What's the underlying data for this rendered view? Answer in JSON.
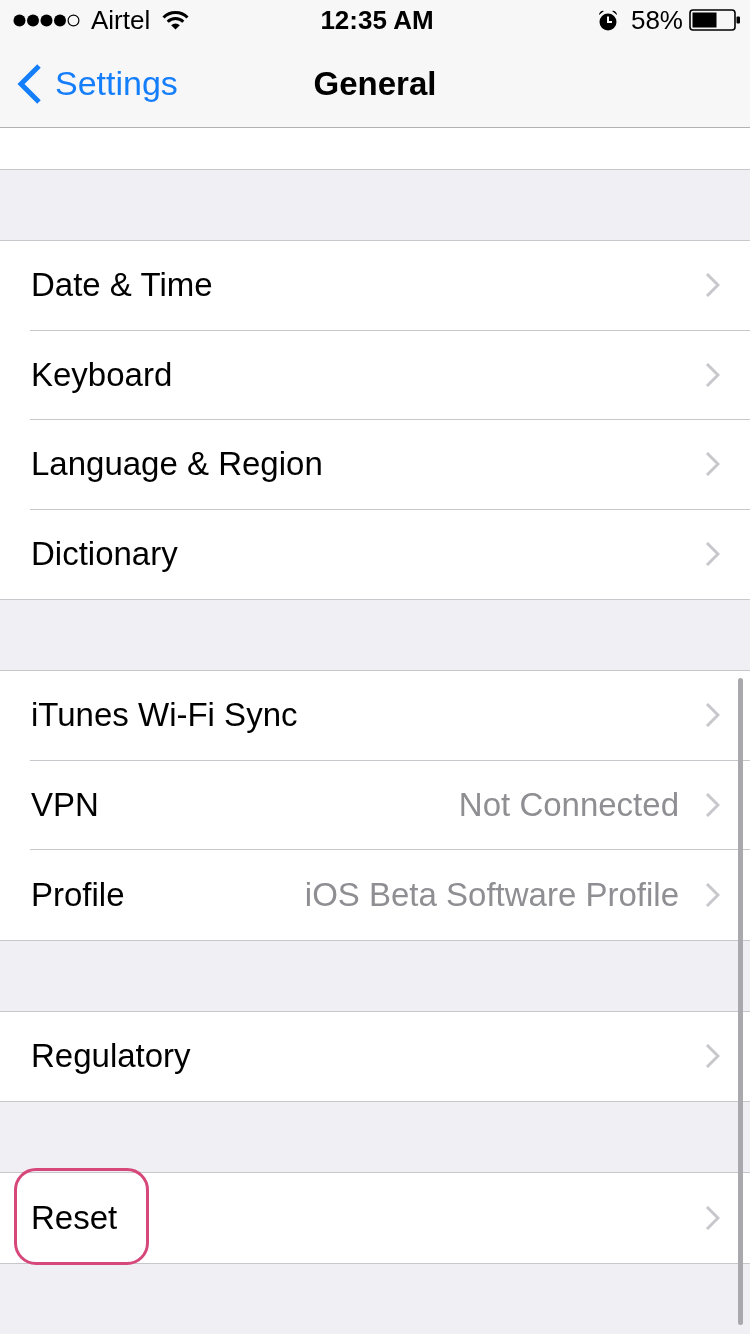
{
  "status_bar": {
    "carrier": "Airtel",
    "time": "12:35 AM",
    "battery": "58%"
  },
  "nav_bar": {
    "back_label": "Settings",
    "title": "General"
  },
  "groups": [
    {
      "rows": [
        {
          "label": "Date & Time",
          "annotated": false
        },
        {
          "label": "Keyboard",
          "annotated": false
        },
        {
          "label": "Language & Region",
          "annotated": false
        },
        {
          "label": "Dictionary",
          "annotated": false
        }
      ]
    },
    {
      "rows": [
        {
          "label": "iTunes Wi-Fi Sync",
          "annotated": false
        },
        {
          "label": "VPN",
          "value": "Not Connected",
          "annotated": false
        },
        {
          "label": "Profile",
          "value": "iOS Beta Software Profile",
          "annotated": false
        }
      ]
    },
    {
      "rows": [
        {
          "label": "Regulatory",
          "annotated": false
        }
      ]
    },
    {
      "rows": [
        {
          "label": "Reset",
          "annotated": true
        }
      ]
    }
  ]
}
